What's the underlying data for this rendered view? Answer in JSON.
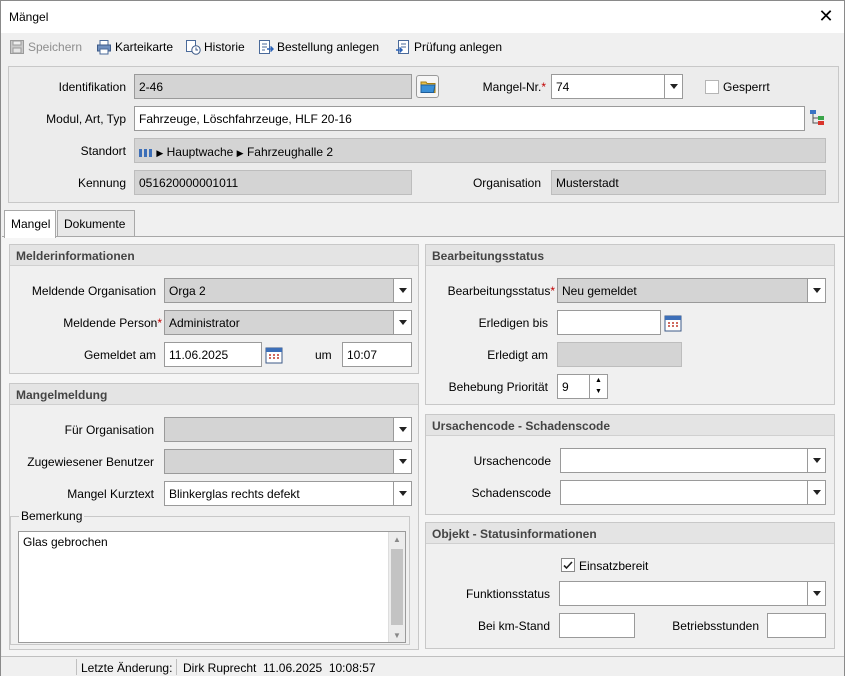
{
  "window": {
    "title": "Mängel"
  },
  "toolbar": {
    "save": "Speichern",
    "karteikarte": "Karteikarte",
    "historie": "Historie",
    "bestellung": "Bestellung anlegen",
    "pruefung": "Prüfung anlegen"
  },
  "header": {
    "identifikation_label": "Identifikation",
    "identifikation_value": "2-46",
    "mangel_nr_label": "Mangel-Nr.",
    "mangel_nr_value": "74",
    "gesperrt_label": "Gesperrt",
    "gesperrt_checked": false,
    "modul_label": "Modul, Art, Typ",
    "modul_value": "Fahrzeuge, Löschfahrzeuge, HLF 20-16",
    "standort_label": "Standort",
    "standort_path": [
      "Hauptwache",
      "Fahrzeughalle 2"
    ],
    "kennung_label": "Kennung",
    "kennung_value": "051620000001011",
    "organisation_label": "Organisation",
    "organisation_value": "Musterstadt"
  },
  "tabs": [
    {
      "label": "Mangel",
      "active": true
    },
    {
      "label": "Dokumente",
      "active": false
    }
  ],
  "melder": {
    "title": "Melderinformationen",
    "org_label": "Meldende Organisation",
    "org_value": "Orga 2",
    "person_label": "Meldende Person",
    "person_value": "Administrator",
    "gemeldet_label": "Gemeldet am",
    "gemeldet_date": "11.06.2025",
    "um_label": "um",
    "gemeldet_time": "10:07"
  },
  "mangelmeldung": {
    "title": "Mangelmeldung",
    "fuer_org_label": "Für Organisation",
    "fuer_org_value": "",
    "benutzer_label": "Zugewiesener Benutzer",
    "benutzer_value": "",
    "kurztext_label": "Mangel Kurztext",
    "kurztext_value": "Blinkerglas rechts defekt",
    "bemerkung_label": "Bemerkung",
    "bemerkung_value": "Glas gebrochen"
  },
  "bearbeitung": {
    "title": "Bearbeitungsstatus",
    "status_label": "Bearbeitungsstatus",
    "status_value": "Neu gemeldet",
    "erledigen_label": "Erledigen bis",
    "erledigen_value": "",
    "erledigt_label": "Erledigt am",
    "erledigt_value": "",
    "prioritaet_label": "Behebung Priorität",
    "prioritaet_value": "9"
  },
  "codes": {
    "title": "Ursachencode - Schadenscode",
    "ursache_label": "Ursachencode",
    "ursache_value": "",
    "schaden_label": "Schadenscode",
    "schaden_value": ""
  },
  "objekt": {
    "title": "Objekt - Statusinformationen",
    "einsatzbereit_label": "Einsatzbereit",
    "einsatzbereit_checked": true,
    "funktion_label": "Funktionsstatus",
    "funktion_value": "",
    "km_label": "Bei km-Stand",
    "km_value": "",
    "betrieb_label": "Betriebsstunden",
    "betrieb_value": ""
  },
  "status": {
    "letzte_label": "Letzte Änderung:",
    "user": "Dirk Ruprecht",
    "datetime": "11.06.2025  10:08:57"
  },
  "colors": {
    "required": "#c00000",
    "readonly_bg": "#d4d4d4"
  },
  "icons": [
    "save-icon",
    "print-icon",
    "history-icon",
    "order-icon",
    "inspection-icon",
    "folder-icon",
    "tree-select-icon",
    "calendar-icon",
    "close-icon",
    "chevron-down-icon"
  ]
}
